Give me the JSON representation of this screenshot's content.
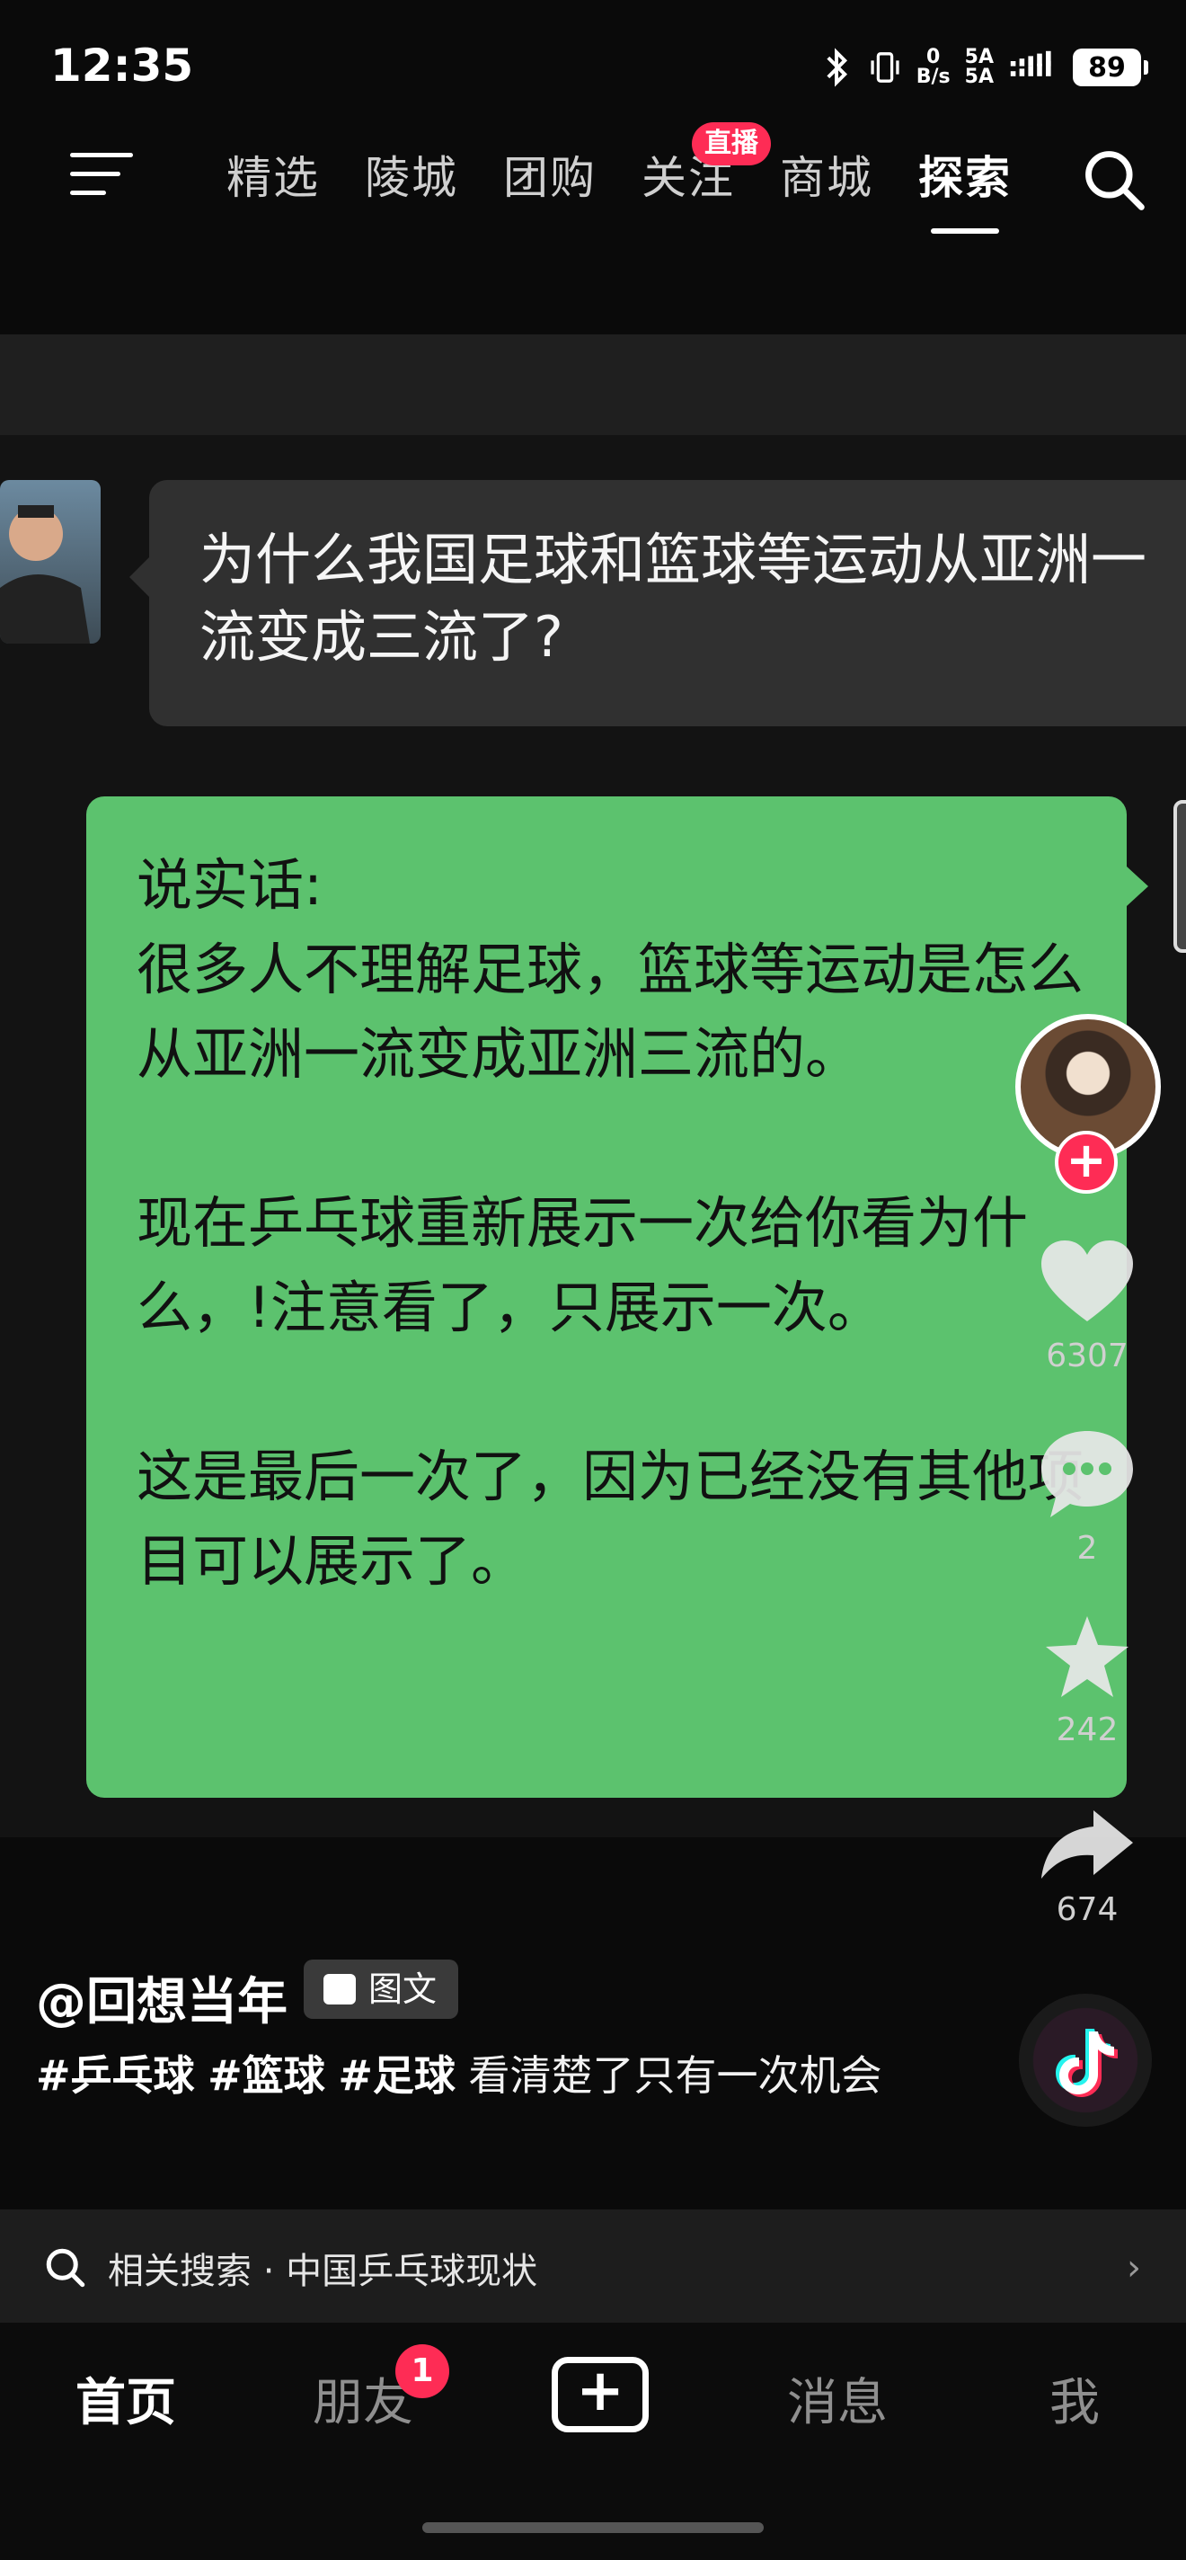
{
  "status_bar": {
    "time": "12:35",
    "net_speed_value": "0",
    "net_speed_unit": "B/s",
    "signal_1": "5A",
    "signal_2": "5A",
    "battery": "89",
    "icons": [
      "bluetooth-icon",
      "vibrate-icon",
      "signal-icon"
    ]
  },
  "top_nav": {
    "tabs": [
      {
        "label": "精选",
        "active": false
      },
      {
        "label": "陵城",
        "active": false
      },
      {
        "label": "团购",
        "active": false
      },
      {
        "label": "关注",
        "active": false
      },
      {
        "label": "商城",
        "active": false
      },
      {
        "label": "探索",
        "active": true
      }
    ],
    "live_badge": "直播"
  },
  "post": {
    "question": "为什么我国足球和篮球等运动从亚洲一流变成三流了?",
    "answer": "说实话:\n很多人不理解足球，篮球等运动是怎么从亚洲一流变成亚洲三流的。\n\n现在乒乓球重新展示一次给你看为什么，!注意看了，只展示一次。\n\n这是最后一次了，因为已经没有其他项目可以展示了。",
    "author": "@回想当年",
    "post_type": "图文",
    "hashtags": [
      "#乒乓球",
      "#篮球",
      "#足球"
    ],
    "caption_text": "看清楚了只有一次机会"
  },
  "actions": {
    "likes": "6307",
    "comments": "2",
    "favorites": "242",
    "shares": "674"
  },
  "related": {
    "label": "相关搜索 · 中国乒乓球现状"
  },
  "bottom_nav": {
    "home": "首页",
    "friends": "朋友",
    "friends_badge": "1",
    "messages": "消息",
    "me": "我"
  },
  "colors": {
    "answer_bubble": "#5cc26e",
    "question_bubble": "#303030",
    "accent": "#fe2c55"
  }
}
